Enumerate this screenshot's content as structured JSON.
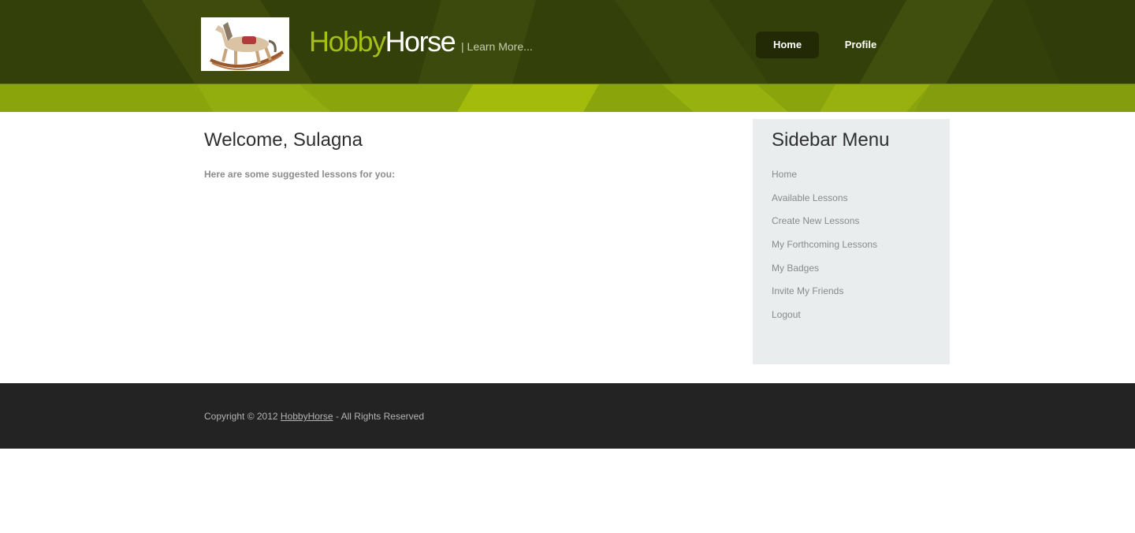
{
  "brand": {
    "name_part1": "Hobby",
    "name_part2": "Horse",
    "tagline": "| Learn More..."
  },
  "nav": {
    "items": [
      {
        "label": "Home",
        "active": true
      },
      {
        "label": "Profile",
        "active": false
      }
    ]
  },
  "main": {
    "welcome": "Welcome, Sulagna",
    "suggestion": "Here are some suggested lessons for you:"
  },
  "sidebar": {
    "title": "Sidebar Menu",
    "items": [
      {
        "label": "Home"
      },
      {
        "label": "Available Lessons"
      },
      {
        "label": "Create New Lessons"
      },
      {
        "label": "My Forthcoming Lessons"
      },
      {
        "label": "My Badges"
      },
      {
        "label": "Invite My Friends"
      },
      {
        "label": "Logout"
      }
    ]
  },
  "footer": {
    "prefix": "Copyright © 2012 ",
    "link": "HobbyHorse",
    "suffix": " - All Rights Reserved"
  },
  "colors": {
    "header_dark": "#34400a",
    "header_band": "#8aa40c",
    "brand_accent": "#a5bf17",
    "sidebar_bg": "#e9edee",
    "footer_bg": "#232323"
  },
  "icons": {
    "logo": "rocking-horse-logo"
  }
}
